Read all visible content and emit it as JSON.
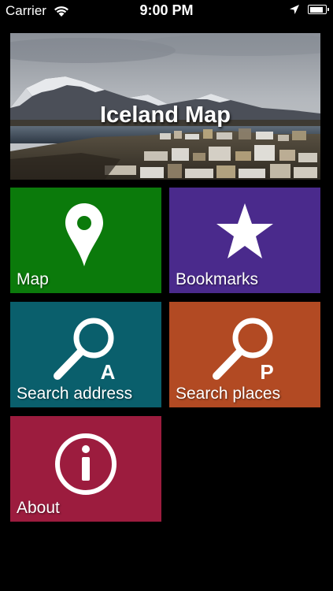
{
  "status_bar": {
    "carrier": "Carrier",
    "time": "9:00 PM",
    "battery_level": 0.9
  },
  "banner": {
    "title": "Iceland Map"
  },
  "tiles": [
    {
      "label": "Map",
      "icon": "map-pin-icon",
      "color": "#0b7a0b"
    },
    {
      "label": "Bookmarks",
      "icon": "star-icon",
      "color": "#4a2a8c"
    },
    {
      "label": "Search address",
      "icon": "search-address-icon",
      "color": "#0a5f6c"
    },
    {
      "label": "Search places",
      "icon": "search-places-icon",
      "color": "#b24a23"
    },
    {
      "label": "About",
      "icon": "info-icon",
      "color": "#9c1c3e"
    }
  ],
  "icon_letters": {
    "address": "A",
    "places": "P"
  }
}
